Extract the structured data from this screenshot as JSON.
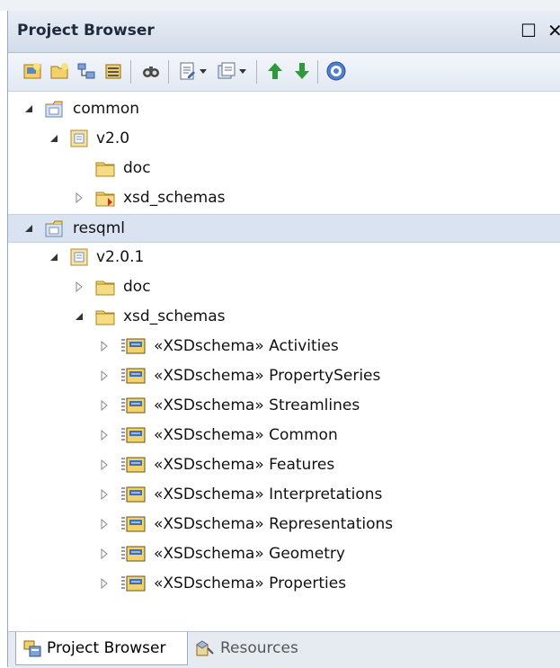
{
  "window": {
    "title": "Project Browser",
    "maximize_glyph": "☐",
    "close_glyph": "✕"
  },
  "toolbar": {
    "buttons": [
      {
        "icon": "new-model-icon"
      },
      {
        "icon": "new-package-icon"
      },
      {
        "icon": "new-diagram-icon"
      },
      {
        "icon": "new-element-icon"
      },
      {
        "icon": "find-binoculars-icon"
      },
      {
        "icon": "document-icon"
      },
      {
        "icon": "dropdown-arrow-icon"
      },
      {
        "icon": "publish-icon"
      },
      {
        "icon": "dropdown-arrow-icon"
      },
      {
        "icon": "move-up-icon"
      },
      {
        "icon": "move-down-icon"
      },
      {
        "icon": "help-icon"
      }
    ]
  },
  "tree": {
    "items": [
      {
        "label": "common",
        "kind": "model",
        "expanded": true,
        "depth": 0
      },
      {
        "label": "v2.0",
        "kind": "view",
        "expanded": true,
        "depth": 1
      },
      {
        "label": "doc",
        "kind": "package",
        "expanded": null,
        "depth": 2
      },
      {
        "label": "xsd_schemas",
        "kind": "package-red",
        "expanded": false,
        "depth": 2
      },
      {
        "label": "resqml",
        "kind": "model",
        "expanded": true,
        "depth": 0
      },
      {
        "label": "v2.0.1",
        "kind": "view",
        "expanded": true,
        "depth": 1
      },
      {
        "label": "doc",
        "kind": "package",
        "expanded": false,
        "depth": 2
      },
      {
        "label": "xsd_schemas",
        "kind": "package",
        "expanded": true,
        "depth": 2
      },
      {
        "label": "«XSDschema» Activities",
        "kind": "schema",
        "expanded": false,
        "depth": 3
      },
      {
        "label": "«XSDschema» PropertySeries",
        "kind": "schema",
        "expanded": false,
        "depth": 3
      },
      {
        "label": "«XSDschema» Streamlines",
        "kind": "schema",
        "expanded": false,
        "depth": 3
      },
      {
        "label": "«XSDschema» Common",
        "kind": "schema",
        "expanded": false,
        "depth": 3
      },
      {
        "label": "«XSDschema» Features",
        "kind": "schema",
        "expanded": false,
        "depth": 3
      },
      {
        "label": "«XSDschema» Interpretations",
        "kind": "schema",
        "expanded": false,
        "depth": 3
      },
      {
        "label": "«XSDschema» Representations",
        "kind": "schema",
        "expanded": false,
        "depth": 3
      },
      {
        "label": "«XSDschema» Geometry",
        "kind": "schema",
        "expanded": false,
        "depth": 3
      },
      {
        "label": "«XSDschema» Properties",
        "kind": "schema",
        "expanded": false,
        "depth": 3
      }
    ]
  },
  "tabs": [
    {
      "label": "Project Browser",
      "icon": "project-browser-icon",
      "active": true
    },
    {
      "label": "Resources",
      "icon": "resources-icon",
      "active": false
    }
  ],
  "colors": {
    "folder": "#f2d36b",
    "selection": "#d9e3f1",
    "arrow_up": "#2e9a3a"
  }
}
